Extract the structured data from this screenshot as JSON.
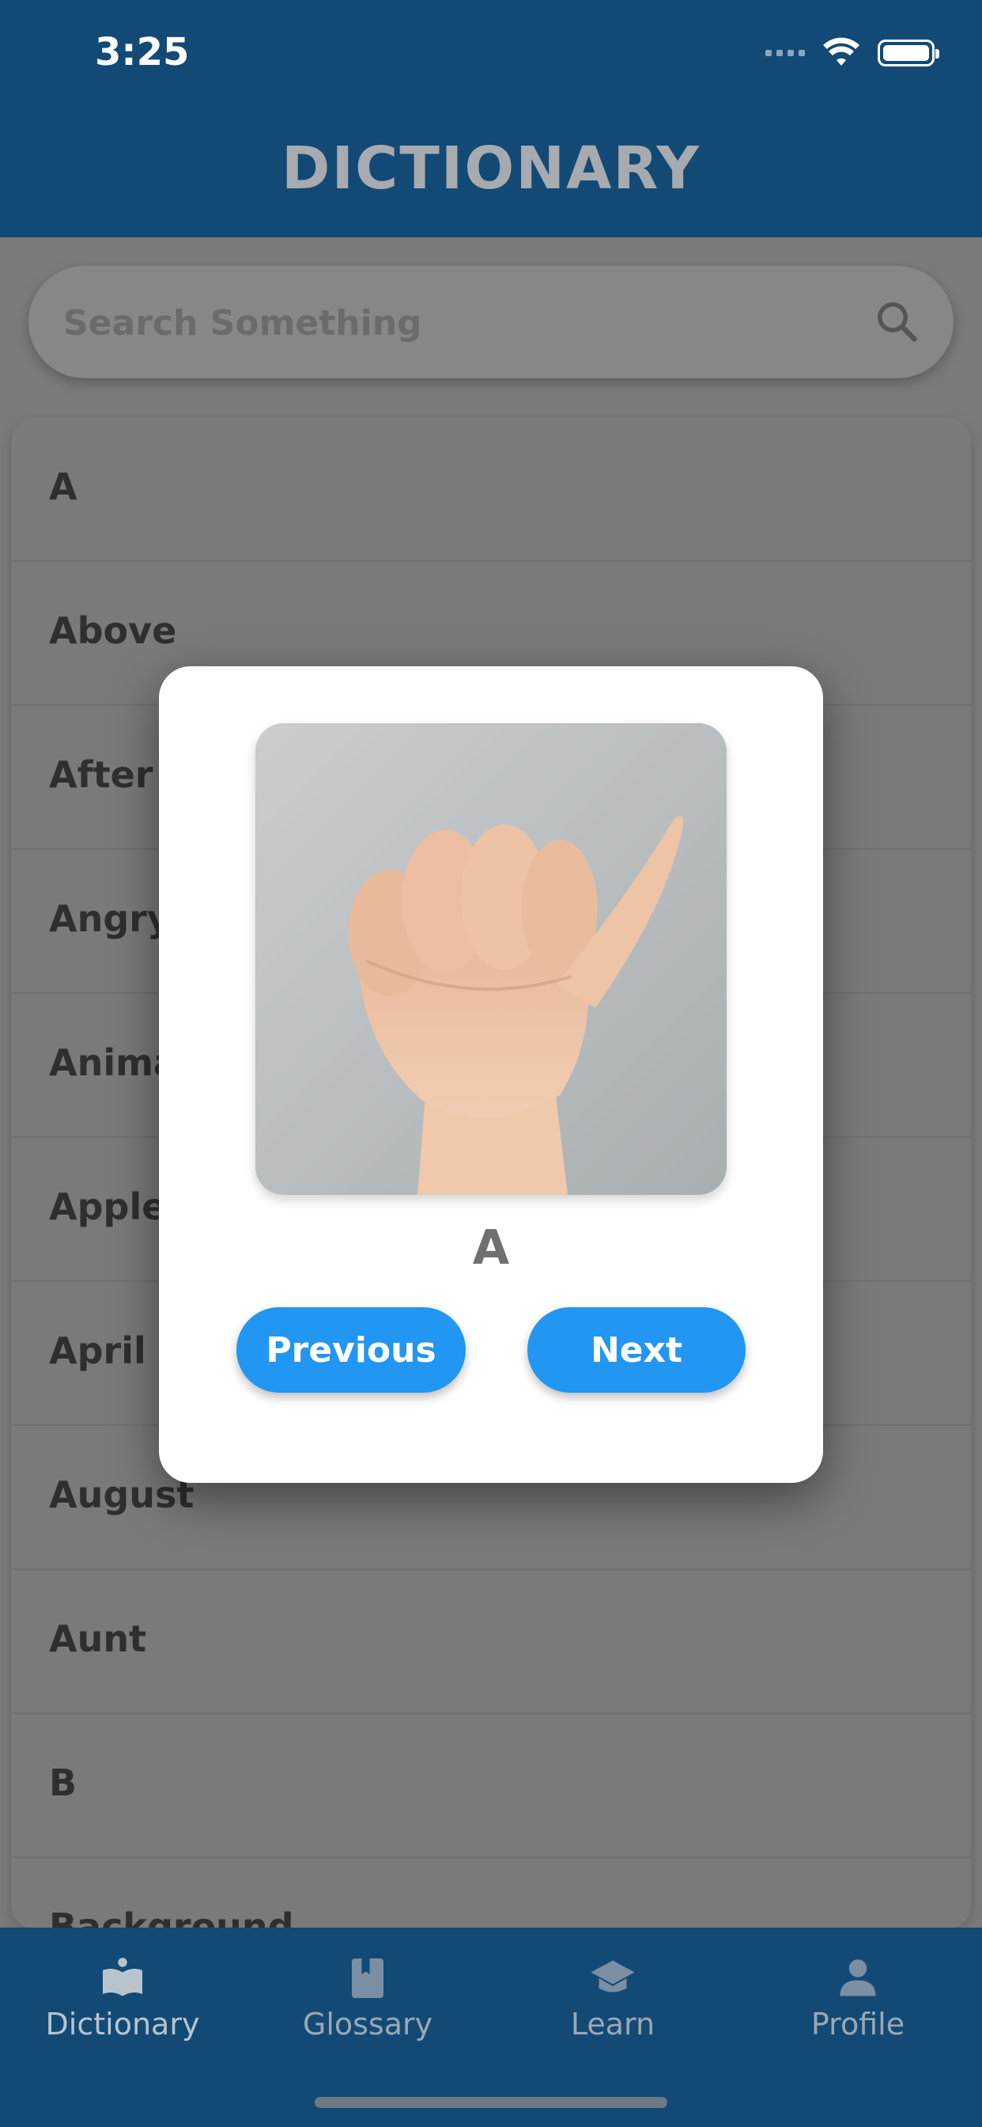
{
  "status_bar": {
    "time": "3:25"
  },
  "header": {
    "title": "DICTIONARY"
  },
  "search": {
    "placeholder": "Search Something"
  },
  "list": {
    "items": [
      {
        "label": "A"
      },
      {
        "label": "Above"
      },
      {
        "label": "After"
      },
      {
        "label": "Angry"
      },
      {
        "label": "Animal"
      },
      {
        "label": "Apple"
      },
      {
        "label": "April"
      },
      {
        "label": "August"
      },
      {
        "label": "Aunt"
      },
      {
        "label": "B"
      },
      {
        "label": "Background"
      }
    ]
  },
  "modal": {
    "image_icon": "hand-sign-a-photo",
    "letter": "A",
    "previous_label": "Previous",
    "next_label": "Next"
  },
  "bottom_nav": {
    "items": [
      {
        "label": "Dictionary",
        "icon": "open-book-icon",
        "active": true
      },
      {
        "label": "Glossary",
        "icon": "bookmark-book-icon",
        "active": false
      },
      {
        "label": "Learn",
        "icon": "graduation-cap-icon",
        "active": false
      },
      {
        "label": "Profile",
        "icon": "person-icon",
        "active": false
      }
    ]
  },
  "colors": {
    "header_bg": "#124a75",
    "accent_button": "#2196f3",
    "overlay_gray": "#7b7b7b"
  }
}
